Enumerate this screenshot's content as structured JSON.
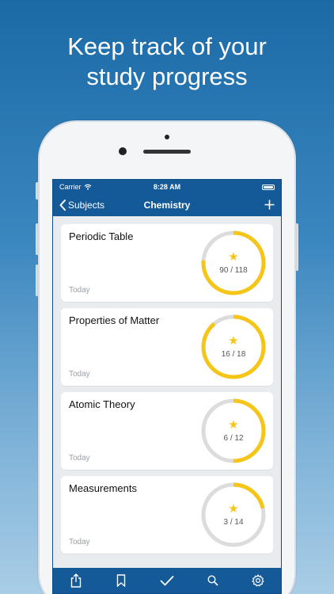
{
  "headline": {
    "line1": "Keep track of your",
    "line2": "study progress"
  },
  "status_bar": {
    "carrier": "Carrier",
    "time": "8:28 AM"
  },
  "nav": {
    "back_label": "Subjects",
    "title": "Chemistry",
    "add_icon": "plus-icon"
  },
  "topics": [
    {
      "name": "Periodic Table",
      "date": "Today",
      "done": 90,
      "total": 118,
      "progress_label": "90 / 118"
    },
    {
      "name": "Properties of Matter",
      "date": "Today",
      "done": 16,
      "total": 18,
      "progress_label": "16 / 18"
    },
    {
      "name": "Atomic Theory",
      "date": "Today",
      "done": 6,
      "total": 12,
      "progress_label": "6 / 12"
    },
    {
      "name": "Measurements",
      "date": "Today",
      "done": 3,
      "total": 14,
      "progress_label": "3 / 14"
    }
  ],
  "tabbar": [
    "share-icon",
    "bookmark-icon",
    "checkmark-icon",
    "search-icon",
    "gear-icon"
  ],
  "colors": {
    "nav_blue": "#155a98",
    "ring_progress": "#f5c518",
    "ring_track": "#dcdcdc",
    "star": "#f5c518"
  }
}
